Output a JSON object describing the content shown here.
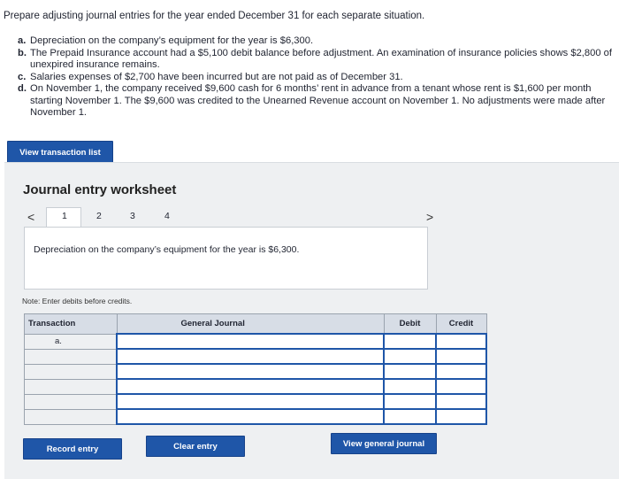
{
  "prompt": "Prepare adjusting journal entries for the year ended December 31 for each separate situation.",
  "situations": [
    {
      "letter": "a.",
      "text": "Depreciation on the company’s equipment for the year is $6,300."
    },
    {
      "letter": "b.",
      "text": "The Prepaid Insurance account had a $5,100 debit balance before adjustment. An examination of insurance policies shows $2,800 of unexpired insurance remains."
    },
    {
      "letter": "c.",
      "text": "Salaries expenses of $2,700 have been incurred but are not paid as of December 31."
    },
    {
      "letter": "d.",
      "text": "On November 1, the company received $9,600 cash for 6 months’ rent in advance from a tenant whose rent is $1,600 per month starting November 1. The $9,600 was credited to the Unearned Revenue account on November 1. No adjustments were made after November 1."
    }
  ],
  "buttons": {
    "view_transactions": "View transaction list",
    "record_entry": "Record entry",
    "clear_entry": "Clear entry",
    "view_journal": "View general journal"
  },
  "worksheet": {
    "title": "Journal entry worksheet",
    "pages": [
      "1",
      "2",
      "3",
      "4"
    ],
    "prev_icon": "<",
    "next_icon": ">",
    "description": "Depreciation on the company’s equipment for the year is $6,300.",
    "note": "Note: Enter debits before credits."
  },
  "table": {
    "headers": {
      "transaction": "Transaction",
      "general_journal": "General Journal",
      "debit": "Debit",
      "credit": "Credit"
    },
    "rows": [
      {
        "transaction": "a."
      },
      {
        "transaction": ""
      },
      {
        "transaction": ""
      },
      {
        "transaction": ""
      },
      {
        "transaction": ""
      },
      {
        "transaction": ""
      }
    ]
  },
  "colors": {
    "accent": "#1f56a8",
    "panel": "#eef0f2",
    "header": "#d7dde6"
  }
}
